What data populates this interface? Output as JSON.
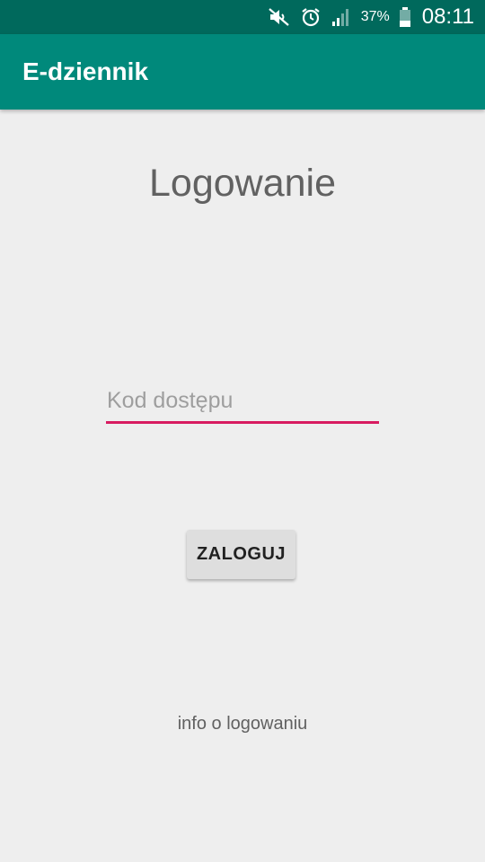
{
  "status_bar": {
    "icons": [
      "mute-icon",
      "alarm-icon",
      "signal-icon",
      "battery-icon"
    ],
    "battery": "37%",
    "time": "08:11"
  },
  "app_bar": {
    "title": "E-dziennik"
  },
  "main": {
    "title": "Logowanie",
    "access_code": {
      "value": "",
      "placeholder": "Kod dostępu"
    },
    "login_button": "ZALOGUJ",
    "info_link": "info o logowaniu"
  },
  "colors": {
    "status_bar": "#00695c",
    "app_bar": "#00897b",
    "accent": "#d81b60",
    "background": "#eeeeee",
    "button": "#dedede"
  }
}
